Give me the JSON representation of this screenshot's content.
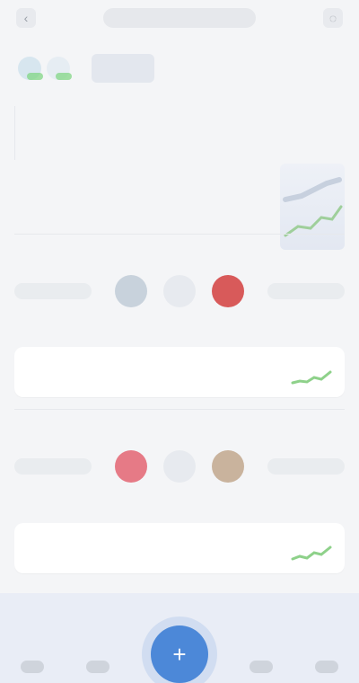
{
  "header": {
    "title": "",
    "left_icon": "back-arrow-icon",
    "right_icon": "notification-bell-icon"
  },
  "summary": {
    "balance_label": "",
    "left_stat_label": "",
    "right_stat_label": ""
  },
  "sections": {
    "section1_title": "",
    "section2_title": ""
  },
  "market_rows": [
    {
      "left_chip": "",
      "mid_token_label": "",
      "right_chip": ""
    },
    {
      "left_chip": "",
      "mid_token_label": "",
      "right_chip": ""
    }
  ],
  "cards": [
    {
      "title": ""
    },
    {
      "title": ""
    }
  ],
  "tabbar": {
    "left_label": "",
    "right_label": ""
  },
  "colors": {
    "accent_green": "#7bd47d",
    "accent_blue": "#4c88d8",
    "accent_red": "#d85a5a"
  },
  "icons": {
    "fab_icon": "plus-icon"
  }
}
